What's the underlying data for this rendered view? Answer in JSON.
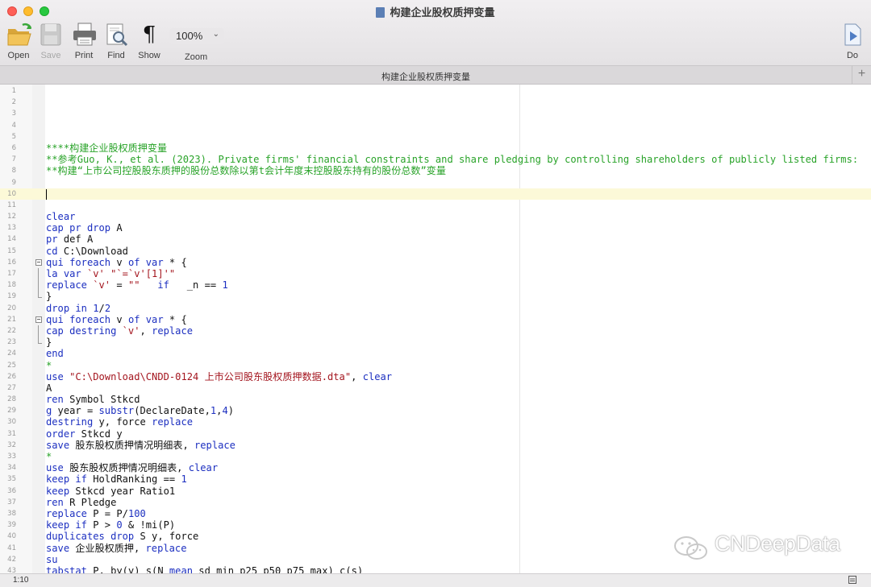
{
  "window": {
    "title": "构建企业股权质押变量"
  },
  "toolbar": {
    "open": "Open",
    "save": "Save",
    "print": "Print",
    "find": "Find",
    "show": "Show",
    "zoom_value": "100%",
    "zoom_label": "Zoom",
    "do": "Do"
  },
  "tab": {
    "title": "构建企业股权质押变量"
  },
  "editor": {
    "current_line": 10,
    "lines": [
      [],
      [],
      [],
      [],
      [],
      [
        [
          "c",
          "****构建企业股权质押变量"
        ]
      ],
      [
        [
          "c",
          "**参考Guo, K., et al. (2023). Private firms' financial constraints and share pledging by controlling shareholders of publicly listed firms:"
        ]
      ],
      [
        [
          "c",
          "**构建“上市公司控股股东质押的股份总数除以第t会计年度末控股股东持有的股份总数”变量"
        ]
      ],
      [],
      [],
      [],
      [
        [
          "k",
          "clear"
        ]
      ],
      [
        [
          "k",
          "cap pr drop"
        ],
        [
          "p",
          " A"
        ]
      ],
      [
        [
          "k",
          "pr"
        ],
        [
          "p",
          " def A"
        ]
      ],
      [
        [
          "k",
          "cd"
        ],
        [
          "p",
          " C:\\Download"
        ]
      ],
      [
        [
          "k",
          "qui foreach"
        ],
        [
          "p",
          " v "
        ],
        [
          "k",
          "of var"
        ],
        [
          "p",
          " * {"
        ]
      ],
      [
        [
          "k",
          "la var"
        ],
        [
          "p",
          " "
        ],
        [
          "m",
          "`v'"
        ],
        [
          "p",
          " "
        ],
        [
          "s",
          "\"`=`v'[1]'\""
        ]
      ],
      [
        [
          "k",
          "replace"
        ],
        [
          "p",
          " "
        ],
        [
          "m",
          "`v'"
        ],
        [
          "p",
          " = "
        ],
        [
          "s",
          "\"\""
        ],
        [
          "p",
          "   "
        ],
        [
          "k",
          "if"
        ],
        [
          "p",
          "   _n == "
        ],
        [
          "n",
          "1"
        ]
      ],
      [
        [
          "p",
          "}"
        ]
      ],
      [
        [
          "k",
          "drop in"
        ],
        [
          "p",
          " "
        ],
        [
          "n",
          "1"
        ],
        [
          "p",
          "/"
        ],
        [
          "n",
          "2"
        ]
      ],
      [
        [
          "k",
          "qui foreach"
        ],
        [
          "p",
          " v "
        ],
        [
          "k",
          "of var"
        ],
        [
          "p",
          " * {"
        ]
      ],
      [
        [
          "k",
          "cap destring"
        ],
        [
          "p",
          " "
        ],
        [
          "m",
          "`v'"
        ],
        [
          "p",
          ", "
        ],
        [
          "k",
          "replace"
        ]
      ],
      [
        [
          "p",
          "}"
        ]
      ],
      [
        [
          "k",
          "end"
        ]
      ],
      [
        [
          "c",
          "*"
        ]
      ],
      [
        [
          "k",
          "use"
        ],
        [
          "p",
          " "
        ],
        [
          "s",
          "\"C:\\Download\\CNDD-0124 上市公司股东股权质押数据.dta\""
        ],
        [
          "p",
          ", "
        ],
        [
          "k",
          "clear"
        ]
      ],
      [
        [
          "p",
          "A"
        ]
      ],
      [
        [
          "k",
          "ren"
        ],
        [
          "p",
          " Symbol Stkcd"
        ]
      ],
      [
        [
          "k",
          "g"
        ],
        [
          "p",
          " year = "
        ],
        [
          "k",
          "substr"
        ],
        [
          "p",
          "(DeclareDate,"
        ],
        [
          "n",
          "1"
        ],
        [
          "p",
          ","
        ],
        [
          "n",
          "4"
        ],
        [
          "p",
          ")"
        ]
      ],
      [
        [
          "k",
          "destring"
        ],
        [
          "p",
          " y, force "
        ],
        [
          "k",
          "replace"
        ]
      ],
      [
        [
          "k",
          "order"
        ],
        [
          "p",
          " Stkcd y"
        ]
      ],
      [
        [
          "k",
          "save"
        ],
        [
          "p",
          " 股东股权质押情况明细表, "
        ],
        [
          "k",
          "replace"
        ]
      ],
      [
        [
          "c",
          "*"
        ]
      ],
      [
        [
          "k",
          "use"
        ],
        [
          "p",
          " 股东股权质押情况明细表, "
        ],
        [
          "k",
          "clear"
        ]
      ],
      [
        [
          "k",
          "keep if"
        ],
        [
          "p",
          " HoldRanking == "
        ],
        [
          "n",
          "1"
        ]
      ],
      [
        [
          "k",
          "keep"
        ],
        [
          "p",
          " Stkcd year Ratio1"
        ]
      ],
      [
        [
          "k",
          "ren"
        ],
        [
          "p",
          " R Pledge"
        ]
      ],
      [
        [
          "k",
          "replace"
        ],
        [
          "p",
          " P = P/"
        ],
        [
          "n",
          "100"
        ]
      ],
      [
        [
          "k",
          "keep if"
        ],
        [
          "p",
          " P > "
        ],
        [
          "n",
          "0"
        ],
        [
          "p",
          " & !mi(P)"
        ]
      ],
      [
        [
          "k",
          "duplicates drop"
        ],
        [
          "p",
          " S y, force"
        ]
      ],
      [
        [
          "k",
          "save"
        ],
        [
          "p",
          " 企业股权质押, "
        ],
        [
          "k",
          "replace"
        ]
      ],
      [
        [
          "k",
          "su"
        ]
      ],
      [
        [
          "k",
          "tabstat"
        ],
        [
          "p",
          " P, by(y) s(N "
        ],
        [
          "k",
          "mean"
        ],
        [
          "p",
          " sd min p25 p50 p75 max) c(s)"
        ]
      ]
    ],
    "fold_marks": {
      "16": "open",
      "17": "mid",
      "18": "mid",
      "19": "end",
      "21": "open",
      "22": "mid",
      "23": "end"
    }
  },
  "watermark": {
    "text": "CNDeepData"
  },
  "status": {
    "position": "1:10"
  }
}
